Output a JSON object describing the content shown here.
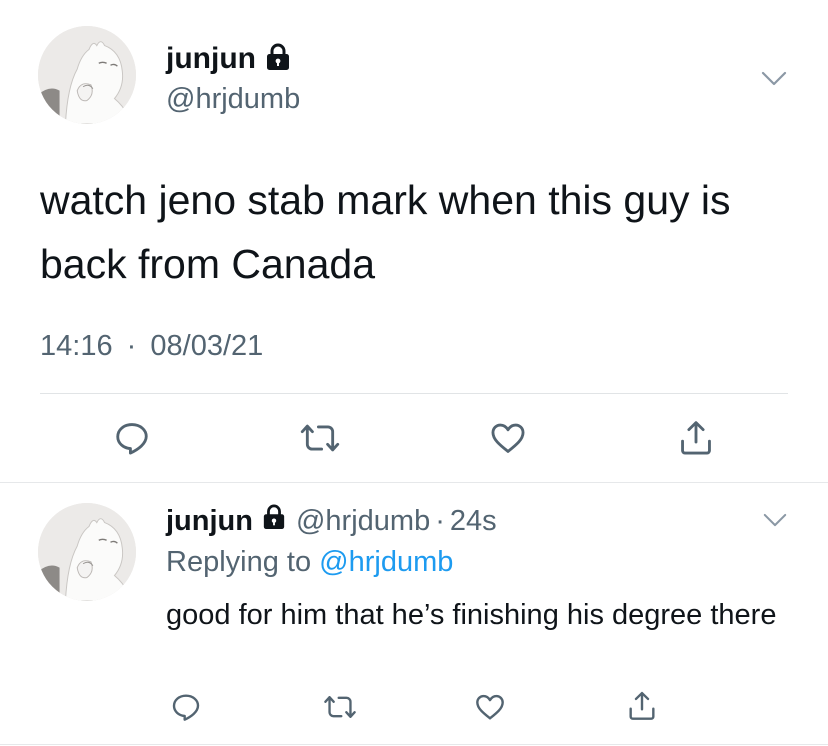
{
  "main_tweet": {
    "display_name": "junjun",
    "handle": "@hrjdumb",
    "text": "watch jeno stab mark when this guy is back from Canada",
    "time": "14:16",
    "separator": "·",
    "date": "08/03/21",
    "icons": {
      "lock": "lock-icon",
      "more": "chevron-down-icon",
      "reply": "reply-icon",
      "retweet": "retweet-icon",
      "like": "heart-icon",
      "share": "share-icon"
    }
  },
  "reply_tweet": {
    "display_name": "junjun",
    "handle": "@hrjdumb",
    "separator": "·",
    "age": "24s",
    "replying_prefix": "Replying to ",
    "replying_to": "@hrjdumb",
    "text": "good for him that he’s finishing his degree there"
  },
  "colors": {
    "text": "#0f1419",
    "secondary": "#536471",
    "link": "#1d9bf0",
    "divider": "#e1e4e6"
  }
}
